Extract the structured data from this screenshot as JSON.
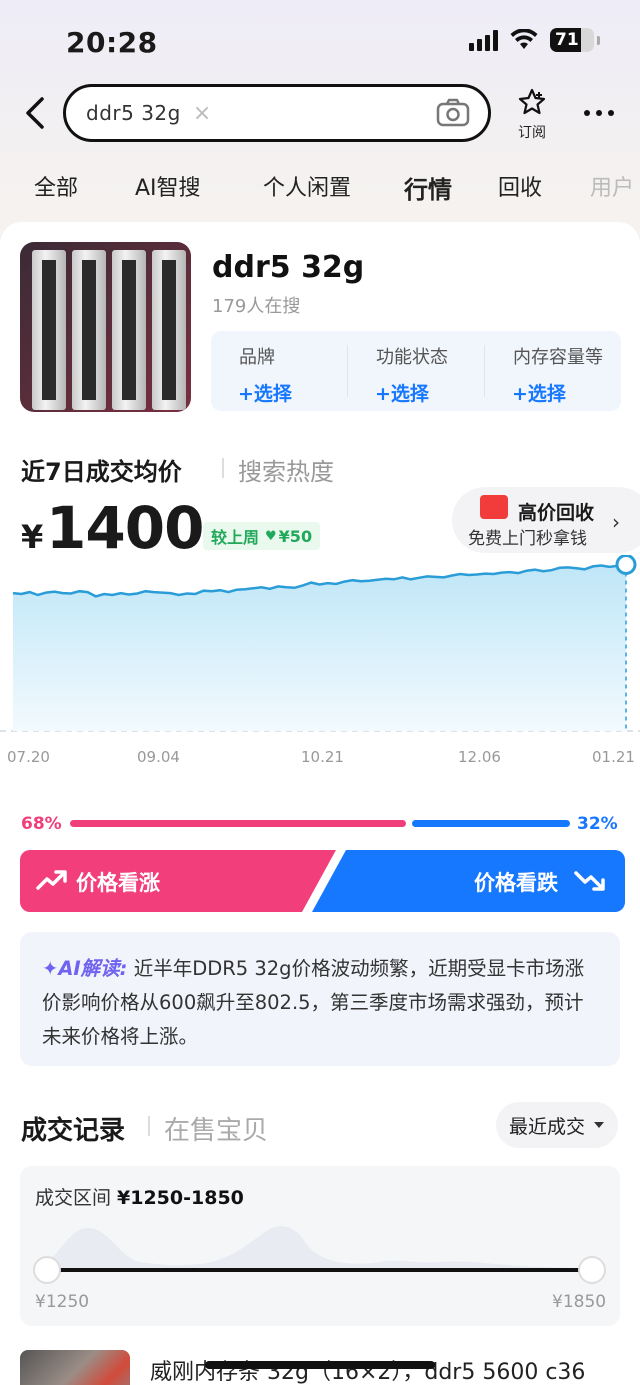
{
  "status_bar": {
    "time": "20:28",
    "battery": "71"
  },
  "search": {
    "query": "ddr5  32g",
    "clear_glyph": "×"
  },
  "header": {
    "subscribe_label": "订阅"
  },
  "tabs": [
    {
      "label": "全部"
    },
    {
      "label": "AI智搜"
    },
    {
      "label": "个人闲置"
    },
    {
      "label": "行情",
      "active": true
    },
    {
      "label": "回收"
    },
    {
      "label": "用户"
    }
  ],
  "product": {
    "title": "ddr5 32g",
    "searching": "179人在搜",
    "filters": [
      {
        "label": "品牌",
        "action": "+选择"
      },
      {
        "label": "功能状态",
        "action": "+选择"
      },
      {
        "label": "内存容量等",
        "action": "+选择"
      }
    ]
  },
  "price_section": {
    "title": "近7日成交均价",
    "alt_tab": "搜索热度",
    "currency": "¥",
    "price": "1400",
    "compare_label": "较上周",
    "compare_value": "¥50",
    "compare_glyph": "♥",
    "recycle": {
      "title": "高价回收",
      "subtitle": "免费上门秒拿钱",
      "chevron": "›"
    }
  },
  "chart_data": {
    "type": "area",
    "x_ticks": [
      "07.20",
      "09.04",
      "10.21",
      "12.06",
      "01.21"
    ],
    "values": [
      1340,
      1338,
      1342,
      1336,
      1341,
      1343,
      1340,
      1339,
      1344,
      1342,
      1333,
      1338,
      1336,
      1340,
      1337,
      1339,
      1344,
      1342,
      1341,
      1340,
      1336,
      1339,
      1338,
      1345,
      1344,
      1346,
      1342,
      1347,
      1348,
      1350,
      1352,
      1349,
      1354,
      1352,
      1351,
      1356,
      1362,
      1358,
      1361,
      1359,
      1364,
      1367,
      1365,
      1366,
      1368,
      1370,
      1369,
      1373,
      1369,
      1372,
      1375,
      1374,
      1373,
      1377,
      1380,
      1378,
      1379,
      1381,
      1380,
      1383,
      1384,
      1382,
      1387,
      1389,
      1386,
      1388,
      1393,
      1394,
      1392,
      1390,
      1396,
      1398,
      1395,
      1397,
      1400
    ],
    "ylim": [
      1050,
      1420
    ],
    "color": "#2a9dd8"
  },
  "vote": {
    "up_pct": "68%",
    "down_pct": "32%",
    "up_share": 0.68,
    "up_label": "价格看涨",
    "down_label": "价格看跌",
    "up_color": "#f03e7a",
    "down_color": "#1677ff"
  },
  "ai": {
    "tag": "✦AI解读:",
    "text": "近半年DDR5 32g价格波动频繁，近期受显卡市场涨价影响价格从600飙升至802.5，第三季度市场需求强劲，预计未来价格将上涨。"
  },
  "records": {
    "title": "成交记录",
    "alt_tab": "在售宝贝",
    "sort_label": "最近成交",
    "range_label": "成交区间",
    "range_value": "¥1250-1850",
    "range_min": "¥1250",
    "range_max": "¥1850",
    "first_item_title": "威刚内存条 32g（16×2），ddr5 5600 c36"
  },
  "icons": [
    "back-icon",
    "camera-icon",
    "subscribe-star-icon",
    "more-icon",
    "trend-up-icon",
    "trend-down-icon",
    "red-packet-icon",
    "sort-caret-icon"
  ]
}
